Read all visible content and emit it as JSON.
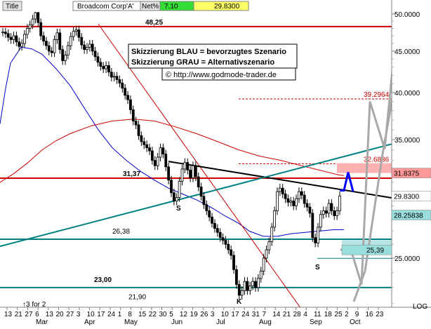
{
  "header": {
    "title_label": "Title",
    "instrument": "Broadcom Corp'A'",
    "net_label": "Net%",
    "net_value": "7.10",
    "price": "29.8300",
    "net_color": "#33dd33",
    "price_color": "#ffff66"
  },
  "notes": {
    "line1": "Skizzierung BLAU = bevorzugtes Szenario",
    "line2": "Skizzierung GRAU = Alternativszenario",
    "copyright": "© http://www.godmode-trader.de"
  },
  "chart_data": {
    "type": "candlestick",
    "y_axis_side": "right",
    "ylim": [
      20.6,
      52
    ],
    "y_ticks": [
      {
        "value": 50,
        "label": "50.0000"
      },
      {
        "value": 45,
        "label": "45.0000"
      },
      {
        "value": 40,
        "label": "40.0000"
      },
      {
        "value": 35,
        "label": "35.0000"
      },
      {
        "value": 30,
        "label": "30.0000"
      },
      {
        "value": 25,
        "label": "25.0000"
      }
    ],
    "scale_label": "LOG",
    "x_day_labels": [
      "13",
      "21",
      "27",
      "6",
      "13",
      "20",
      "27",
      "3",
      "10",
      "17",
      "24",
      "1",
      "8",
      "15",
      "22",
      "30",
      "5",
      "12",
      "19",
      "26",
      "3",
      "10",
      "17",
      "24",
      "31",
      "7",
      "14",
      "21",
      "28",
      "4",
      "11",
      "18",
      "25",
      "2",
      "9",
      "16",
      "23"
    ],
    "x_month_labels": [
      "Mar",
      "Apr",
      "May",
      "Jun",
      "Jul",
      "Aug",
      "Sep",
      "Oct"
    ],
    "horizontal_levels": [
      {
        "value": 48.25,
        "label": "48,25",
        "color": "#cc0000"
      },
      {
        "value": 31.37,
        "label": "31,37",
        "color": "#cc0000"
      },
      {
        "value": 26.38,
        "label": "26,38",
        "color": "#008080"
      },
      {
        "value": 23.0,
        "label": "23,00",
        "color": "#008080"
      },
      {
        "value": 21.9,
        "label": "21,90",
        "color": "#008080"
      }
    ],
    "target_levels": [
      {
        "value": 39.2964,
        "label": "39.2964",
        "color": "#cc0000"
      },
      {
        "value": 32.6836,
        "label": "32.6836",
        "color": "#cc0000"
      }
    ],
    "price_boxes": [
      {
        "value": 31.8375,
        "label": "31.8375",
        "fill": "#ff9999"
      },
      {
        "value": 29.83,
        "label": "29.8300",
        "fill": "#ffffff"
      },
      {
        "value": 28.25838,
        "label": "28.25838",
        "fill": "#99dddd"
      },
      {
        "value": 25.39,
        "label": "25,39",
        "fill": "#99dddd"
      }
    ],
    "point_labels": [
      "S",
      "S",
      "S",
      "K"
    ],
    "split_note": "↑3 for 2",
    "series": [
      {
        "name": "Price",
        "type": "candle",
        "values": [
          47.5,
          47.3,
          46.8,
          46.5,
          47.0,
          46.2,
          45.6,
          46.0,
          47.2,
          48.0,
          48.5,
          49.3,
          50.2,
          48.8,
          47.0,
          46.3,
          45.7,
          45.0,
          44.8,
          46.5,
          47.4,
          45.2,
          43.8,
          44.5,
          45.7,
          46.9,
          47.6,
          47.8,
          46.8,
          45.8,
          45.2,
          45.5,
          45.9,
          45.0,
          44.3,
          43.6,
          43.1,
          42.8,
          43.2,
          42.4,
          41.8,
          41.9,
          41.5,
          41.1,
          40.5,
          39.7,
          39.2,
          38.1,
          36.9,
          36.5,
          35.4,
          34.8,
          34.5,
          34.2,
          33.9,
          33.0,
          32.5,
          33.3,
          34.2,
          33.6,
          32.4,
          31.2,
          30.1,
          29.4,
          29.7,
          31.1,
          32.2,
          32.8,
          32.1,
          31.4,
          32.5,
          31.5,
          30.6,
          29.8,
          29.1,
          28.6,
          28.1,
          27.6,
          27.2,
          26.9,
          26.5,
          26.3,
          26.0,
          25.6,
          25.2,
          24.2,
          23.2,
          22.5,
          22.8,
          23.4,
          22.8,
          23.1,
          23.4,
          23.0,
          23.6,
          24.1,
          25.0,
          25.6,
          26.2,
          27.3,
          28.6,
          30.2,
          30.5,
          30.0,
          29.6,
          29.3,
          29.4,
          29.0,
          29.6,
          30.2,
          29.9,
          29.2,
          28.9,
          28.4,
          26.5,
          26.1,
          27.3,
          28.3,
          28.6,
          28.4,
          29.2,
          28.6,
          28.2,
          28.6,
          29.83
        ]
      },
      {
        "name": "MA",
        "type": "line",
        "color": "#0000cc",
        "values": [
          [
            0,
            36.6
          ],
          [
            8,
            40.5
          ],
          [
            15,
            43.5
          ],
          [
            30,
            45.5
          ],
          [
            45,
            45.3
          ],
          [
            60,
            44.6
          ],
          [
            80,
            42.8
          ],
          [
            100,
            40.8
          ],
          [
            120,
            38.3
          ],
          [
            140,
            36.0
          ],
          [
            160,
            34.2
          ],
          [
            180,
            33.0
          ],
          [
            200,
            32.0
          ],
          [
            220,
            31.2
          ],
          [
            240,
            30.5
          ],
          [
            260,
            30.0
          ],
          [
            280,
            29.5
          ],
          [
            300,
            28.9
          ],
          [
            320,
            28.2
          ],
          [
            340,
            27.6
          ],
          [
            355,
            27.0
          ],
          [
            375,
            26.6
          ],
          [
            395,
            26.6
          ],
          [
            415,
            26.8
          ],
          [
            435,
            26.9
          ],
          [
            455,
            27.0
          ],
          [
            475,
            27.1
          ],
          [
            490,
            27.1
          ]
        ]
      },
      {
        "name": "MA200",
        "type": "line",
        "color": "#cc0000",
        "values": [
          [
            0,
            31.0
          ],
          [
            20,
            31.8
          ],
          [
            40,
            32.8
          ],
          [
            60,
            34.0
          ],
          [
            80,
            34.9
          ],
          [
            100,
            35.6
          ],
          [
            130,
            36.4
          ],
          [
            160,
            36.9
          ],
          [
            190,
            37.1
          ],
          [
            220,
            36.9
          ],
          [
            250,
            36.3
          ],
          [
            280,
            35.6
          ],
          [
            310,
            34.8
          ],
          [
            340,
            34.0
          ],
          [
            370,
            33.4
          ],
          [
            400,
            33.0
          ],
          [
            430,
            32.5
          ],
          [
            455,
            32.1
          ],
          [
            480,
            31.7
          ],
          [
            490,
            31.6
          ]
        ]
      }
    ],
    "trendlines": [
      {
        "name": "steep-downtrend",
        "color": "#cc0000",
        "points": [
          [
            140,
            48.6
          ],
          [
            440,
            21.0
          ]
        ]
      },
      {
        "name": "downtrend",
        "color": "#000000",
        "points": [
          [
            240,
            32.9
          ],
          [
            560,
            29.65
          ]
        ]
      },
      {
        "name": "uptrend",
        "color": "#008080",
        "points": [
          [
            0,
            25.85
          ],
          [
            560,
            34.6
          ]
        ]
      }
    ],
    "scenarios": [
      {
        "name": "preferred",
        "color": "#0000ff",
        "points": [
          [
            484,
            30.3
          ],
          [
            490,
            30.3
          ],
          [
            496,
            31.9
          ],
          [
            503,
            30.2
          ]
        ]
      },
      {
        "name": "alternative",
        "color": "#a8a8a8",
        "points": [
          [
            485,
            25.6
          ],
          [
            500,
            25.6
          ],
          [
            515,
            23.2
          ],
          [
            527,
            39.0
          ],
          [
            548,
            34.1
          ],
          [
            562,
            45.3
          ],
          [
            577,
            47.4
          ],
          [
            606,
            50.6
          ],
          [
            590,
            34.0
          ],
          [
            568,
            44.2
          ],
          [
            555,
            37.6
          ],
          [
            545,
            33.6
          ],
          [
            520,
            24.1
          ],
          [
            504,
            22.1
          ]
        ]
      }
    ]
  }
}
